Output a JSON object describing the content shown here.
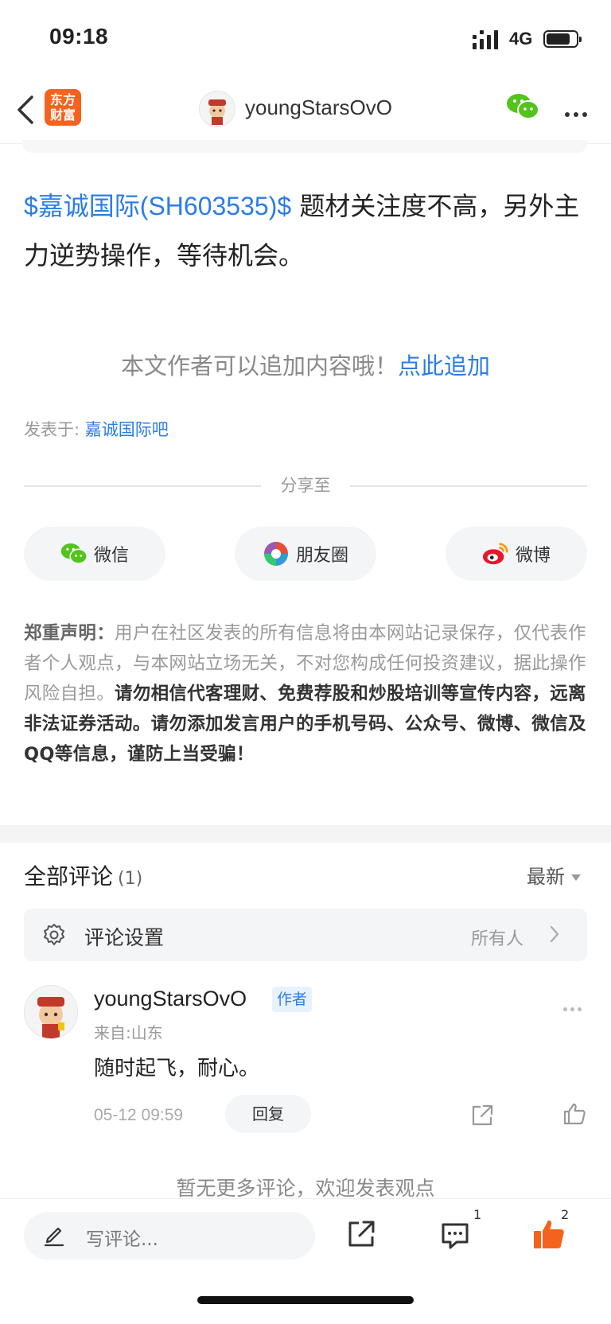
{
  "status_bar": {
    "time": "09:18",
    "network": "4G",
    "battery_level": 0.8
  },
  "nav": {
    "logo_text": "东方财富",
    "title": "youngStarsOvO"
  },
  "post": {
    "stock_link": "$嘉诚国际(SH603535)$",
    "text": " 题材关注度不高，另外主力逆势操作，等待机会。"
  },
  "append": {
    "prompt": "本文作者可以追加内容哦！",
    "link": "点此追加"
  },
  "published": {
    "label": "发表于: ",
    "forum": "嘉诚国际吧"
  },
  "share": {
    "label": "分享至",
    "buttons": [
      {
        "label": "微信",
        "icon": "wechat-icon"
      },
      {
        "label": "朋友圈",
        "icon": "moments-icon"
      },
      {
        "label": "微博",
        "icon": "weibo-icon"
      }
    ]
  },
  "disclaimer": {
    "lead": "郑重声明：",
    "normal": "用户在社区发表的所有信息将由本网站记录保存，仅代表作者个人观点，与本网站立场无关，不对您构成任何投资建议，据此操作风险自担。",
    "bold": "请勿相信代客理财、免费荐股和炒股培训等宣传内容，远离非法证券活动。请勿添加发言用户的手机号码、公众号、微博、微信及QQ等信息，谨防上当受骗！"
  },
  "comments": {
    "title": "全部评论",
    "count": "(1)",
    "sort": "最新",
    "settings_label": "评论设置",
    "settings_value": "所有人",
    "items": [
      {
        "name": "youngStarsOvO",
        "badge": "作者",
        "location": "来自:山东",
        "text": "随时起飞，耐心。",
        "time": "05-12 09:59",
        "reply": "回复"
      }
    ],
    "no_more": "暂无更多评论，欢迎发表观点"
  },
  "bottom_bar": {
    "placeholder": "写评论...",
    "comment_count": "1",
    "like_count": "2"
  },
  "colors": {
    "link": "#2b7de9",
    "brand": "#f5621e",
    "like": "#f5621e",
    "wechat": "#52c41a"
  }
}
